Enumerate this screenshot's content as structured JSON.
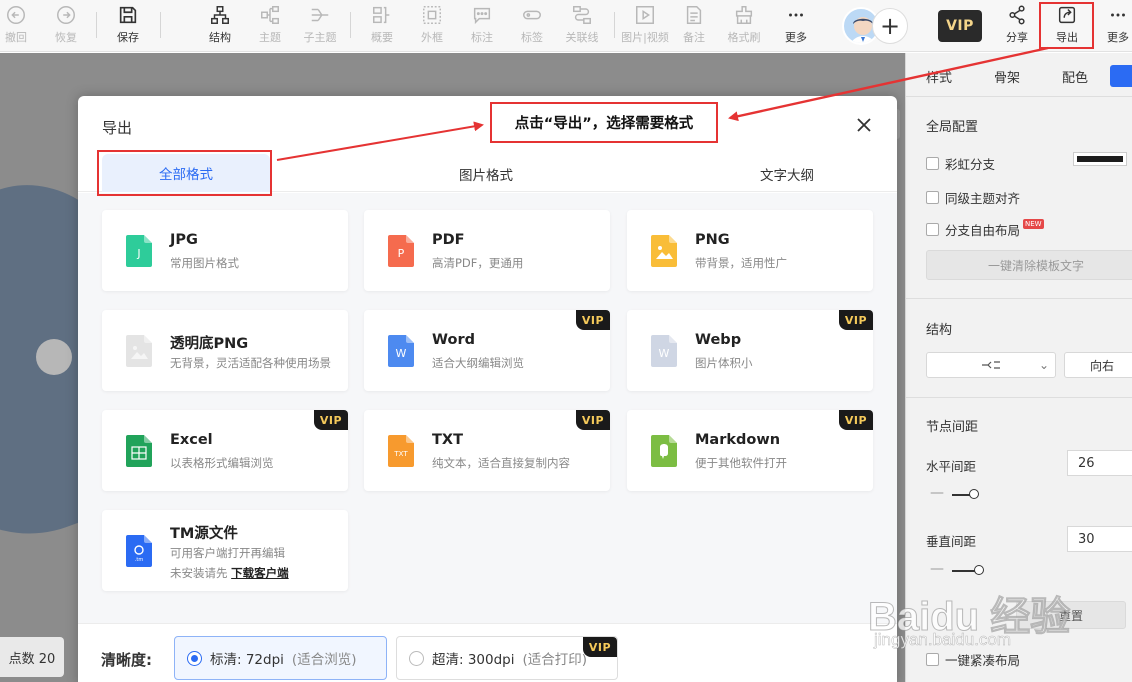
{
  "toolbar": {
    "items": [
      {
        "label": "撤回",
        "icon": "undo-icon"
      },
      {
        "label": "恢复",
        "icon": "redo-icon"
      },
      {
        "label": "保存",
        "icon": "save-icon"
      },
      {
        "label": "结构",
        "icon": "structure-icon"
      },
      {
        "label": "主题",
        "icon": "topic-icon"
      },
      {
        "label": "子主题",
        "icon": "subtopic-icon"
      },
      {
        "label": "概要",
        "icon": "summary-icon"
      },
      {
        "label": "外框",
        "icon": "frame-icon"
      },
      {
        "label": "标注",
        "icon": "callout-icon"
      },
      {
        "label": "标签",
        "icon": "tag-icon"
      },
      {
        "label": "关联线",
        "icon": "relation-line-icon"
      },
      {
        "label": "图片|视频",
        "icon": "media-icon"
      },
      {
        "label": "备注",
        "icon": "note-icon"
      },
      {
        "label": "格式刷",
        "icon": "format-brush-icon"
      },
      {
        "label": "更多",
        "icon": "more-icon"
      },
      {
        "label": "分享",
        "icon": "share-icon"
      },
      {
        "label": "导出",
        "icon": "export-icon"
      },
      {
        "label": "更多",
        "icon": "more-icon"
      }
    ],
    "vip_label": "VIP",
    "add_symbol": "+"
  },
  "canvas": {
    "node_count": "点数 20",
    "collapse_symbol": "›"
  },
  "right_panel": {
    "tabs": [
      "样式",
      "骨架",
      "配色"
    ],
    "global_config": "全局配置",
    "checks": [
      "彩虹分支",
      "同级主题对齐",
      "分支自由布局"
    ],
    "new_badge": "NEW",
    "clear_template_button": "一键清除模板文字",
    "structure_heading": "结构",
    "structure_direction": "向右",
    "node_spacing_heading": "节点间距",
    "horizontal_label": "水平间距",
    "horizontal_value": "26",
    "vertical_label": "垂直间距",
    "vertical_value": "30",
    "compact_layout": "一键紧凑布局",
    "partial_button": "重置"
  },
  "dialog": {
    "title": "导出",
    "tabs": [
      "全部格式",
      "图片格式",
      "文字大纲"
    ],
    "formats": [
      {
        "name": "JPG",
        "desc": "常用图片格式",
        "vip": false,
        "icon": "jpg-file-icon",
        "color": "#2ecc9a",
        "glyph": "J"
      },
      {
        "name": "PDF",
        "desc": "高清PDF，更通用",
        "vip": false,
        "icon": "pdf-file-icon",
        "color": "#f56b4e",
        "glyph": "P"
      },
      {
        "name": "PNG",
        "desc": "带背景，适用性广",
        "vip": false,
        "icon": "png-file-icon",
        "color": "#f9bd38",
        "glyph": ""
      },
      {
        "name": "透明底PNG",
        "desc": "无背景，灵活适配各种使用场景",
        "vip": false,
        "icon": "transparent-png-file-icon",
        "color": "#e4e4e4",
        "glyph": ""
      },
      {
        "name": "Word",
        "desc": "适合大纲编辑浏览",
        "vip": true,
        "icon": "word-file-icon",
        "color": "#4d8af0",
        "glyph": "W"
      },
      {
        "name": "Webp",
        "desc": "图片体积小",
        "vip": true,
        "icon": "webp-file-icon",
        "color": "#cfd6e4",
        "glyph": "W"
      },
      {
        "name": "Excel",
        "desc": "以表格形式编辑浏览",
        "vip": true,
        "icon": "excel-file-icon",
        "color": "#21a35a",
        "glyph": "X"
      },
      {
        "name": "TXT",
        "desc": "纯文本，适合直接复制内容",
        "vip": true,
        "icon": "txt-file-icon",
        "color": "#f79a2e",
        "glyph": "TXT"
      },
      {
        "name": "Markdown",
        "desc": "便于其他软件打开",
        "vip": true,
        "icon": "markdown-file-icon",
        "color": "#7cbd43",
        "glyph": "M"
      },
      {
        "name": "TM源文件",
        "desc": "可用客户端打开再编辑",
        "desc2": "未安装请先",
        "link": "下载客户端",
        "vip": false,
        "icon": "tm-file-icon",
        "color": "#2b6bf3",
        "glyph": ".tm"
      }
    ],
    "vip_label": "VIP",
    "quality_label": "清晰度:",
    "quality_options": [
      {
        "label": "标清: 72dpi",
        "hint": "(适合浏览)",
        "selected": true,
        "vip": false
      },
      {
        "label": "超清: 300dpi",
        "hint": "(适合打印)",
        "selected": false,
        "vip": true
      }
    ]
  },
  "annotation": {
    "callout_text": "点击“导出”，选择需要格式",
    "color": "#e53333"
  },
  "watermark": {
    "main": "Baidu 经验",
    "sub": "jingyan.baidu.com"
  }
}
